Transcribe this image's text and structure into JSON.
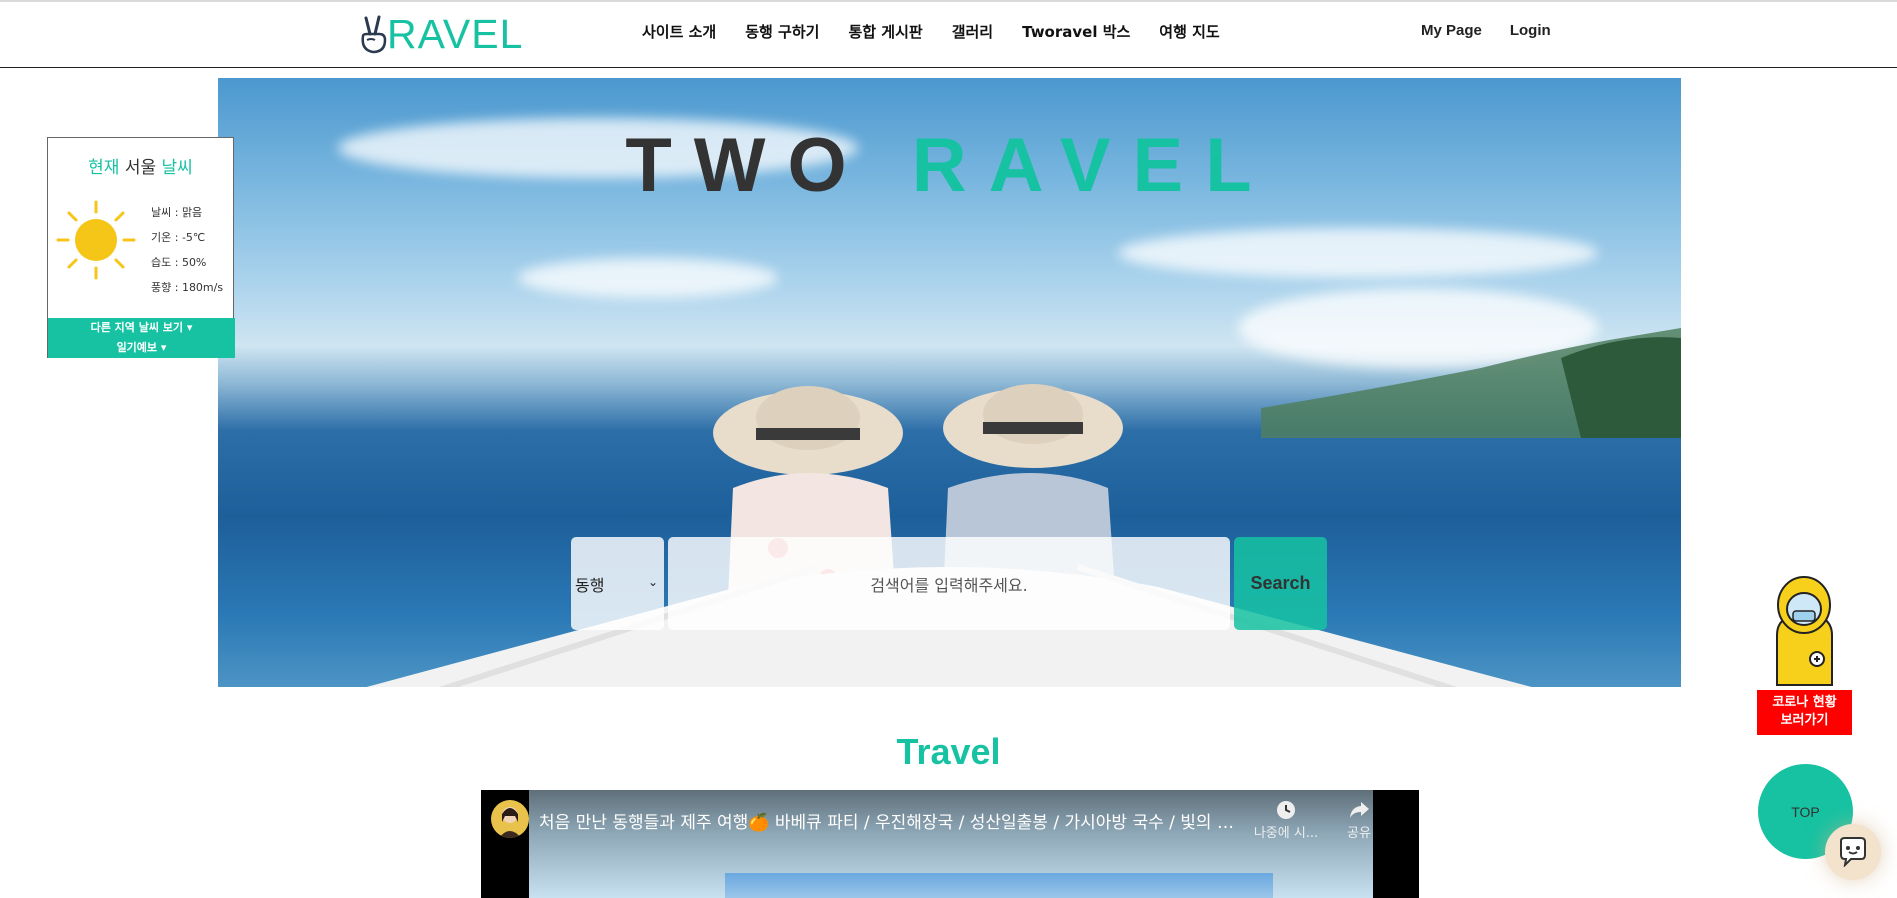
{
  "header": {
    "logo_text": "RAVEL",
    "nav": [
      "사이트 소개",
      "동행 구하기",
      "통합 게시판",
      "갤러리",
      "Tworavel 박스",
      "여행 지도"
    ],
    "my_page": "My Page",
    "login": "Login"
  },
  "hero": {
    "title_dark": "TWO",
    "title_teal": "RAVEL",
    "search_select_value": "동행",
    "search_placeholder": "검색어를 입력해주세요.",
    "search_button": "Search"
  },
  "weather": {
    "title_now": "현재",
    "title_city": "서울",
    "title_weather": "날씨",
    "icon": "sun-icon",
    "condition": "날씨 : 맑음",
    "temperature": "기온 : -5℃",
    "humidity": "습도 : 50%",
    "wind": "풍향 : 180m/s",
    "other_regions": "다른 지역 날씨 보기",
    "forecast": "일기예보"
  },
  "travel": {
    "section_title": "Travel",
    "video_title": "처음 만난 동행들과 제주 여행🍊 바베큐 파티 / 우진해장국 / 성산일출봉 / 가시아방 국수 / 빛의 벙커",
    "watch_later": "나중에 시...",
    "share": "공유"
  },
  "floating": {
    "covid_label_line1": "코로나 현황",
    "covid_label_line2": "보러가기",
    "top_button": "TOP"
  },
  "colors": {
    "accent": "#16c2a2",
    "covid_red": "#ff0000"
  }
}
